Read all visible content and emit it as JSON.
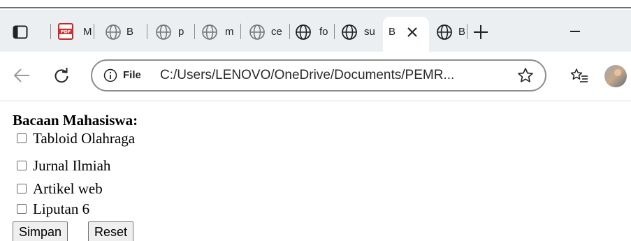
{
  "browser": {
    "tabs": [
      {
        "fragment": "M",
        "icon": "pdf-icon"
      },
      {
        "fragment": "B",
        "icon": "globe-icon"
      },
      {
        "fragment": "p",
        "icon": "globe-icon"
      },
      {
        "fragment": "m",
        "icon": "globe-icon"
      },
      {
        "fragment": "ce",
        "icon": "globe-icon"
      },
      {
        "fragment": "fo",
        "icon": "globe-icon"
      },
      {
        "fragment": "su",
        "icon": "globe-icon"
      },
      {
        "fragment": "B",
        "icon": "globe-icon",
        "active": true
      },
      {
        "fragment": "B",
        "icon": "globe-icon"
      }
    ],
    "address": {
      "scheme_label": "File",
      "url": "C:/Users/LENOVO/OneDrive/Documents/PEMR..."
    }
  },
  "page": {
    "heading": "Bacaan Mahasiswa:",
    "options": [
      {
        "label": "Tabloid Olahraga",
        "checked": false
      },
      {
        "label": "Jurnal Ilmiah",
        "checked": false
      },
      {
        "label": "Artikel web",
        "checked": false
      },
      {
        "label": "Liputan 6",
        "checked": false
      }
    ],
    "buttons": {
      "submit": "Simpan",
      "reset": "Reset"
    }
  }
}
